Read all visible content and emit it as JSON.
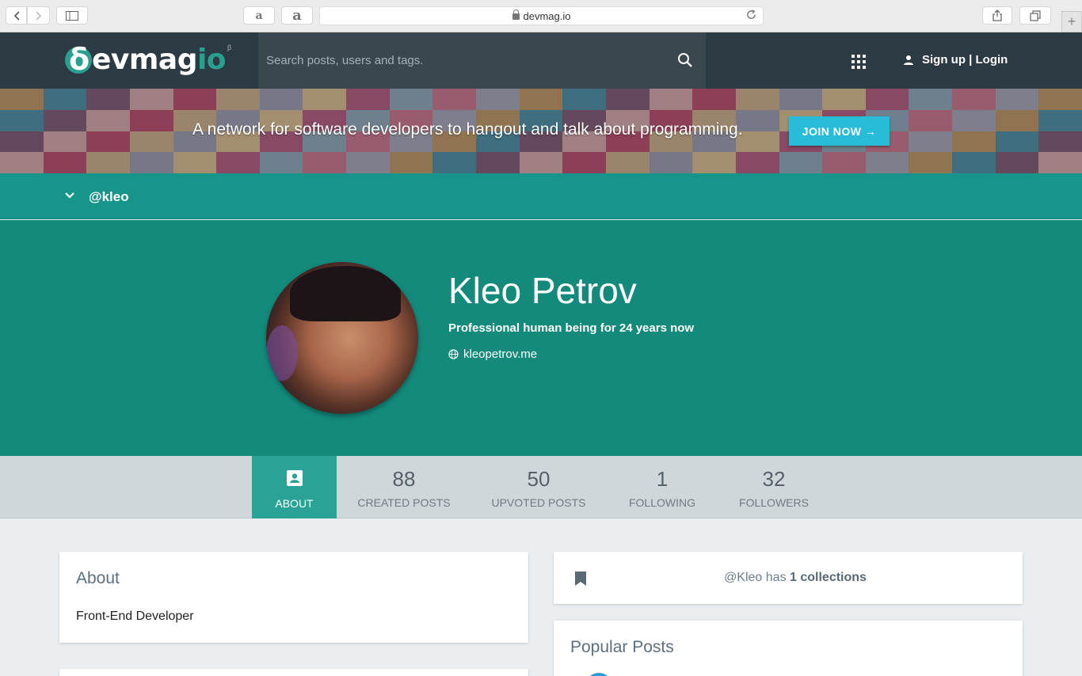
{
  "browser": {
    "url": "devmag.io",
    "reader_glyph": "a",
    "amazon_glyph": "a",
    "new_tab_glyph": "+"
  },
  "header": {
    "logo_text": "evmag",
    "logo_io": "io",
    "logo_beta": "β",
    "search_placeholder": "Search posts, users and tags.",
    "auth_label": "Sign up | Login"
  },
  "banner": {
    "tagline": "A network for software developers to hangout and talk about programming.",
    "join_label": "JOIN NOW →"
  },
  "handle": "@kleo",
  "profile": {
    "name": "Kleo Petrov",
    "bio": "Professional human being for 24 years now",
    "website": "kleopetrov.me"
  },
  "stats": {
    "about_label": "ABOUT",
    "items": [
      {
        "value": "88",
        "label": "CREATED POSTS"
      },
      {
        "value": "50",
        "label": "UPVOTED POSTS"
      },
      {
        "value": "1",
        "label": "FOLLOWING"
      },
      {
        "value": "32",
        "label": "FOLLOWERS"
      }
    ]
  },
  "about_card": {
    "title": "About",
    "text": "Front-End Developer"
  },
  "collections_card": {
    "prefix": "@Kleo has ",
    "count_text": "1 collections"
  },
  "popular_card": {
    "title": "Popular Posts"
  },
  "colors": {
    "header_bg": "#2c3a43",
    "teal": "#17958a",
    "profile_bg": "#138a7c",
    "join_button": "#28bcd8"
  }
}
